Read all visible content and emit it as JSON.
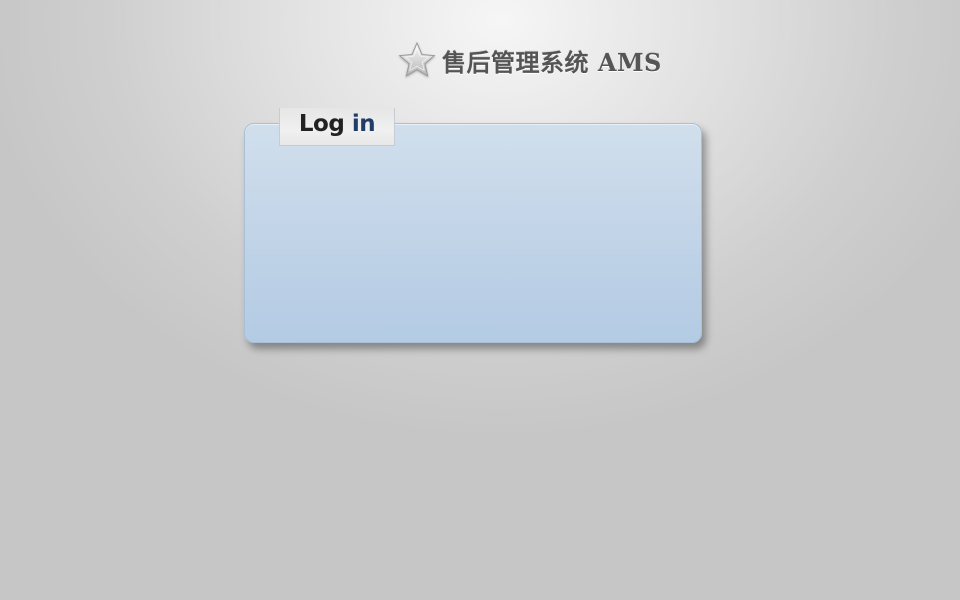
{
  "app": {
    "title": "售后管理系统 AMS",
    "logo_icon": "star-icon"
  },
  "login_panel": {
    "tab_label_part1": "Log ",
    "tab_label_part2": "in"
  },
  "colors": {
    "background": "#d0d0d0",
    "panel": "#c3d5e8",
    "tab": "#ececec",
    "title_text": "#555555"
  }
}
